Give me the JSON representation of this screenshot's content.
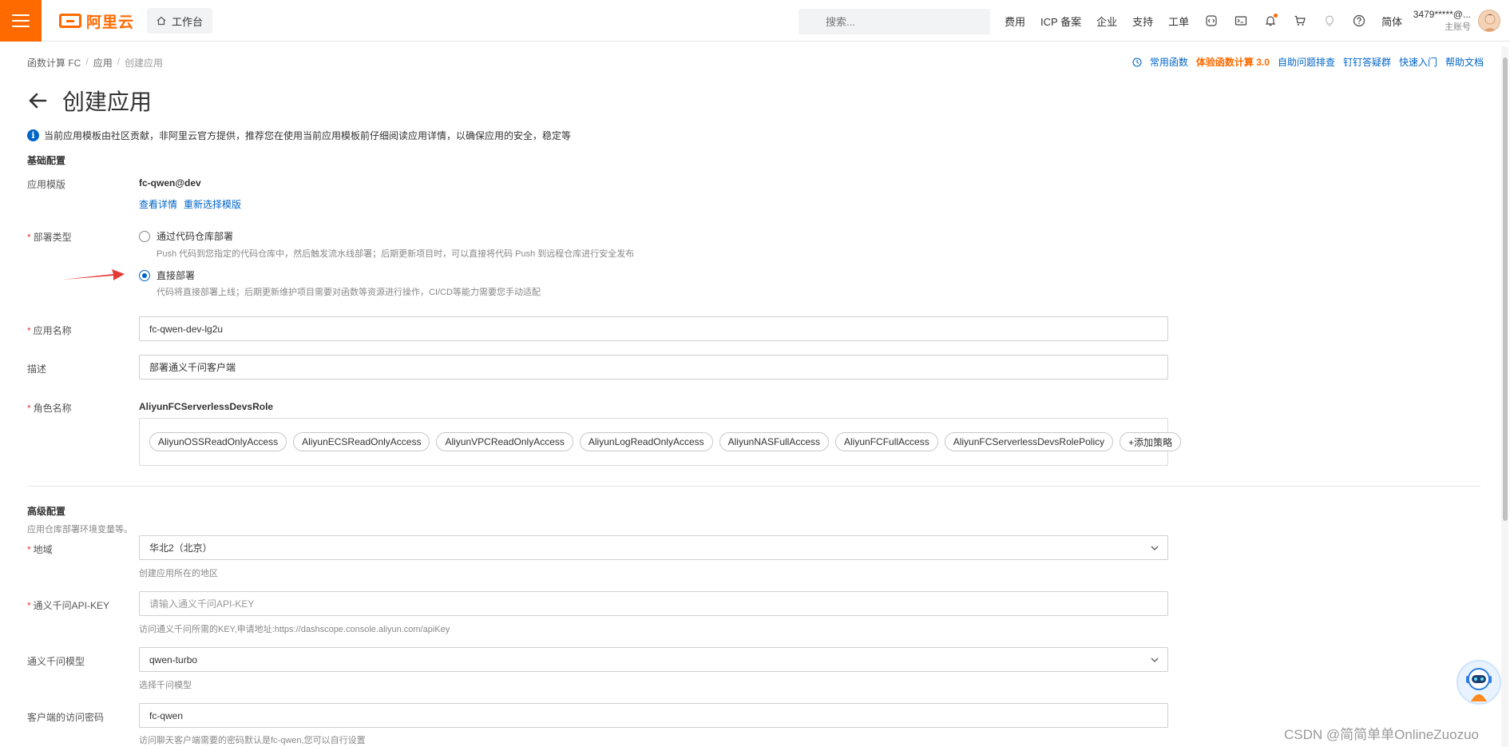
{
  "topbar": {
    "logo_text": "阿里云",
    "workbench_label": "工作台",
    "search_placeholder": "搜索...",
    "links": [
      "费用",
      "ICP 备案",
      "企业",
      "支持",
      "工单"
    ],
    "lang": "简体",
    "account_name": "3479*****@...",
    "account_type": "主账号"
  },
  "breadcrumb": {
    "items": [
      "函数计算 FC",
      "应用"
    ],
    "current": "创建应用"
  },
  "quick_links": {
    "common_functions": "常用函数",
    "trial": "体验函数计算 3.0",
    "troubleshoot": "自助问题排查",
    "dingtalk": "钉钉答疑群",
    "quick_start": "快速入门",
    "help": "帮助文档"
  },
  "page": {
    "title": "创建应用",
    "notice": "当前应用模板由社区贡献，非阿里云官方提供，推荐您在使用当前应用模板前仔细阅读应用详情，以确保应用的安全，稳定等"
  },
  "basic": {
    "section_title": "基础配置",
    "template_label": "应用模版",
    "template_value": "fc-qwen@dev",
    "view_details": "查看详情",
    "reselect": "重新选择模版",
    "deploy_label": "部署类型",
    "deploy_option1": "通过代码仓库部署",
    "deploy_option1_hint": "Push 代码到您指定的代码仓库中，然后触发流水线部署；后期更新项目时，可以直接将代码 Push 到远程仓库进行安全发布",
    "deploy_option2": "直接部署",
    "deploy_option2_hint": "代码将直接部署上线；后期更新维护项目需要对函数等资源进行操作，CI/CD等能力需要您手动适配",
    "app_name_label": "应用名称",
    "app_name_value": "fc-qwen-dev-lg2u",
    "desc_label": "描述",
    "desc_value": "部署通义千问客户端",
    "role_label": "角色名称",
    "role_value": "AliyunFCServerlessDevsRole",
    "policies": [
      "AliyunOSSReadOnlyAccess",
      "AliyunECSReadOnlyAccess",
      "AliyunVPCReadOnlyAccess",
      "AliyunLogReadOnlyAccess",
      "AliyunNASFullAccess",
      "AliyunFCFullAccess",
      "AliyunFCServerlessDevsRolePolicy"
    ],
    "add_policy": "+添加策略"
  },
  "advanced": {
    "section_title": "高级配置",
    "section_hint": "应用仓库部署环境变量等。",
    "region_label": "地域",
    "region_value": "华北2（北京）",
    "region_hint": "创建应用所在的地区",
    "apikey_label": "通义千问API-KEY",
    "apikey_placeholder": "请输入通义千问API-KEY",
    "apikey_hint": "访问通义千问所需的KEY,申请地址:https://dashscope.console.aliyun.com/apiKey",
    "model_label": "通义千问模型",
    "model_value": "qwen-turbo",
    "model_hint": "选择千问模型",
    "pwd_label": "客户端的访问密码",
    "pwd_value": "fc-qwen",
    "pwd_hint": "访问聊天客户端需要的密码默认是fc-qwen,您可以自行设置"
  },
  "watermark": "CSDN @简简单单OnlineZuozuo",
  "colors": {
    "accent": "#ff6a00",
    "link": "#0064c8",
    "required": "#e4393c"
  }
}
